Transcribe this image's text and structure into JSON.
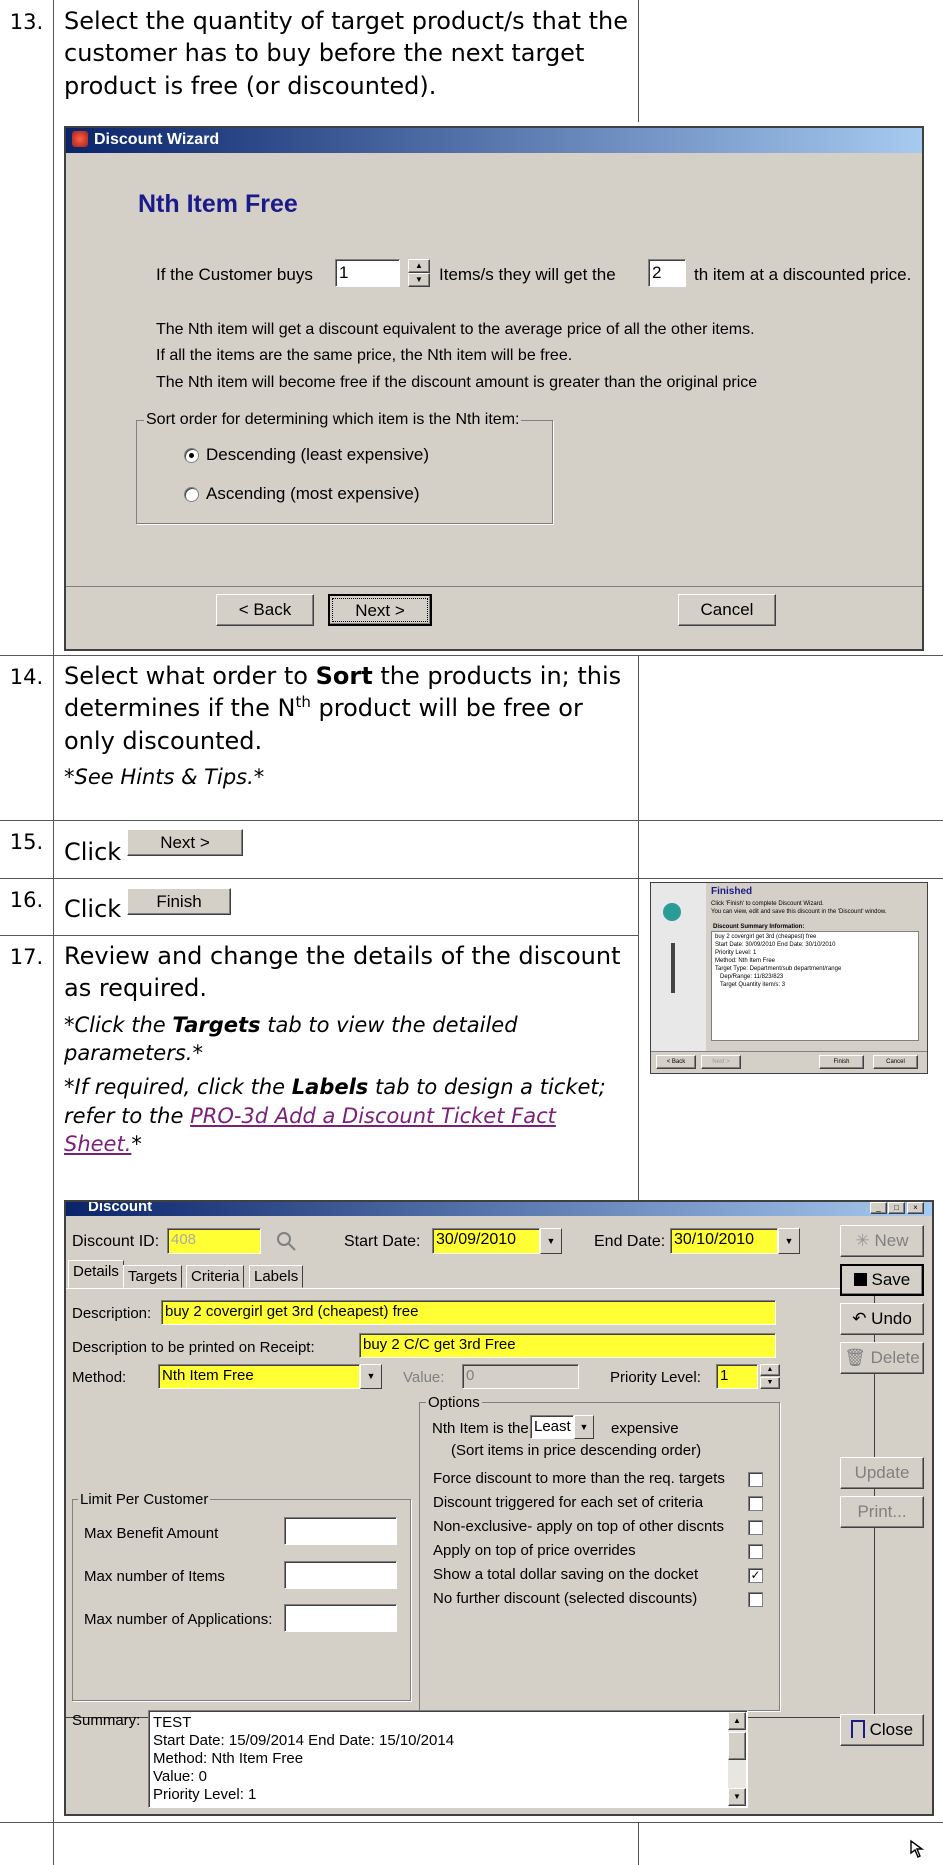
{
  "steps": {
    "s13": {
      "num": "13.",
      "text": "Select the quantity of target product/s that the customer has to buy before the next target product is free (or discounted)."
    },
    "s14": {
      "num": "14.",
      "text_a": "Select what order to ",
      "text_bold": "Sort",
      "text_b": " the products in; this determines if the N",
      "sup": "th",
      "text_c": " product will be free or only discounted.",
      "note": "*See Hints & Tips.*"
    },
    "s15": {
      "num": "15.",
      "click": "Click",
      "button": "Next >"
    },
    "s16": {
      "num": "16.",
      "click": "Click",
      "button": "Finish"
    },
    "s17": {
      "num": "17.",
      "text": "Review and change the details of the discount as required.",
      "note1_a": "*Click the ",
      "note1_bold": "Targets",
      "note1_b": " tab to view the detailed parameters.*",
      "note2_a": "*If required, click the ",
      "note2_bold": "Labels",
      "note2_b": " tab to design a ticket; refer to the ",
      "note2_link": "PRO-3d Add a Discount Ticket Fact Sheet.",
      "note2_c": "*"
    }
  },
  "wizard": {
    "title": "Discount Wizard",
    "heading": "Nth Item Free",
    "buys_label": "If the Customer buys",
    "buys_value": "1",
    "items_label": "Items/s they will get the",
    "nth_value": "2",
    "nth_label": "th item at a discounted price.",
    "info1": "The Nth item will get a discount equivalent to the average price of all the other items.",
    "info2": "If all the items are the same price, the Nth item will be free.",
    "info3": "The Nth item will become free if the discount amount is greater than the original price",
    "group_label": "Sort order for determining which item is the Nth item:",
    "opt_desc": "Descending (least expensive)",
    "opt_asc": "Ascending (most expensive)",
    "back": "< Back",
    "next": "Next >",
    "cancel": "Cancel"
  },
  "finished_thumb": {
    "title": "Finished",
    "line1": "Click 'Finish' to complete Discount Wizard.",
    "line2": "You can view, edit and save this discount in the 'Discount' window.",
    "summary_title": "Discount Summary Information:",
    "summary": [
      "buy 2 covergirl get 3rd (cheapest) free",
      "Start Date: 30/09/2010    End Date: 30/10/2010",
      "Priority Level: 1",
      "Method: Nth Item Free",
      "Target Type: Department/sub department/range",
      "Dep/Range: 11/823/823",
      "Target Quantity item/s: 3"
    ],
    "back": "< Back",
    "next": "Next >",
    "finish": "Finish",
    "cancel": "Cancel"
  },
  "discount": {
    "title": "Discount",
    "id_label": "Discount ID:",
    "id_value": "408",
    "start_label": "Start Date:",
    "start_value": "30/09/2010",
    "end_label": "End Date:",
    "end_value": "30/10/2010",
    "tabs": [
      "Details",
      "Targets",
      "Criteria",
      "Labels"
    ],
    "desc_label": "Description:",
    "desc_value": "buy 2 covergirl get 3rd (cheapest) free",
    "receipt_label": "Description to be printed on Receipt:",
    "receipt_value": "buy 2 C/C get 3rd Free",
    "method_label": "Method:",
    "method_value": "Nth Item Free",
    "value_label": "Value:",
    "value_value": "0",
    "priority_label": "Priority Level:",
    "priority_value": "1",
    "options_label": "Options",
    "nth_is_the": "Nth Item is the",
    "nth_select": "Least",
    "expensive": "expensive",
    "sort_note": "(Sort items in price descending order)",
    "opt_force": "Force discount to more than the req. targets",
    "opt_trigger": "Discount triggered for each set of criteria",
    "opt_nonex": "Non-exclusive- apply on top of other discnts",
    "opt_override": "Apply on top of price overrides",
    "opt_saving": "Show a total dollar saving on the docket",
    "opt_nofurther": "No further discount (selected discounts)",
    "limit_label": "Limit Per Customer",
    "max_benefit": "Max Benefit Amount",
    "max_items": "Max number of Items",
    "max_apps": "Max number of Applications:",
    "summary_label": "Summary:",
    "summary_lines": [
      "TEST",
      "Start Date: 15/09/2014    End Date: 15/10/2014",
      "Method: Nth Item Free",
      "Value: 0",
      "Priority Level: 1"
    ],
    "btn_new": "New",
    "btn_save": "Save",
    "btn_undo": "Undo",
    "btn_delete": "Delete",
    "btn_update": "Update",
    "btn_print": "Print...",
    "btn_close": "Close"
  }
}
